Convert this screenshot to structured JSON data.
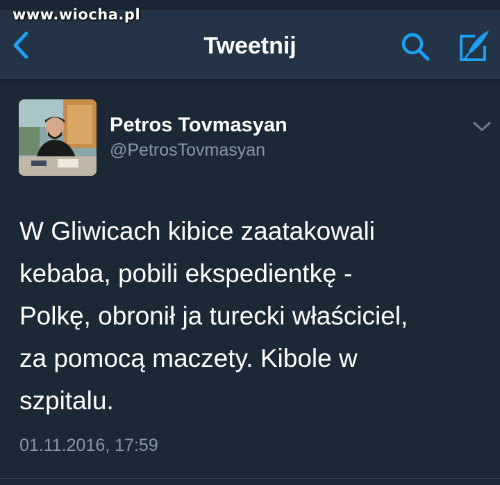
{
  "watermark": "www.wiocha.pl",
  "header": {
    "title": "Tweetnij",
    "back_icon": "chevron-left-icon",
    "search_icon": "search-icon",
    "compose_icon": "compose-icon",
    "accent": "#1da1f2"
  },
  "tweet": {
    "author_name": "Petros Tovmasyan",
    "author_handle": "@PetrosTovmasyan",
    "text_lines": [
      "W Gliwicach kibice zaatakowali",
      "kebaba, pobili ekspedientkę -",
      "Polkę, obronił ja turecki właściciel,",
      "za pomocą maczety. Kibole w",
      "szpitalu."
    ],
    "timestamp": "01.11.2016, 17:59",
    "menu_icon": "chevron-down-icon"
  },
  "colors": {
    "background": "#1b2836",
    "header_bg": "#243447",
    "secondary_text": "#8899a6"
  }
}
